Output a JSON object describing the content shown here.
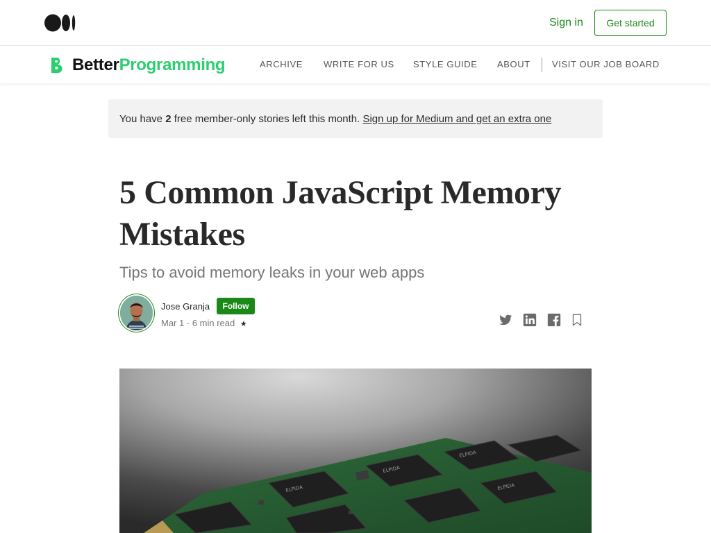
{
  "header": {
    "logo_icon": "medium-logo-icon",
    "signin_label": "Sign in",
    "get_started_label": "Get started",
    "accent": "#1a8917"
  },
  "publication": {
    "name_part1": "Better",
    "name_part2": "Programming",
    "logo_icon": "better-programming-logo-icon",
    "brand_color": "#2bcf6f",
    "nav": [
      "ARCHIVE",
      "WRITE FOR US",
      "STYLE GUIDE",
      "ABOUT",
      "VISIT OUR JOB BOARD"
    ]
  },
  "banner": {
    "prefix": "You have ",
    "count": "2",
    "suffix": " free member-only stories left this month. ",
    "link": "Sign up for Medium and get an extra one"
  },
  "article": {
    "title": "5 Common JavaScript Memory Mistakes",
    "subtitle": "Tips to avoid memory leaks in your web apps",
    "author": "Jose Granja",
    "follow_label": "Follow",
    "date": "Mar 1",
    "separator": "·",
    "read_time": "6 min read",
    "star": "★"
  },
  "share_icons": [
    "twitter-icon",
    "linkedin-icon",
    "facebook-icon",
    "bookmark-icon"
  ]
}
